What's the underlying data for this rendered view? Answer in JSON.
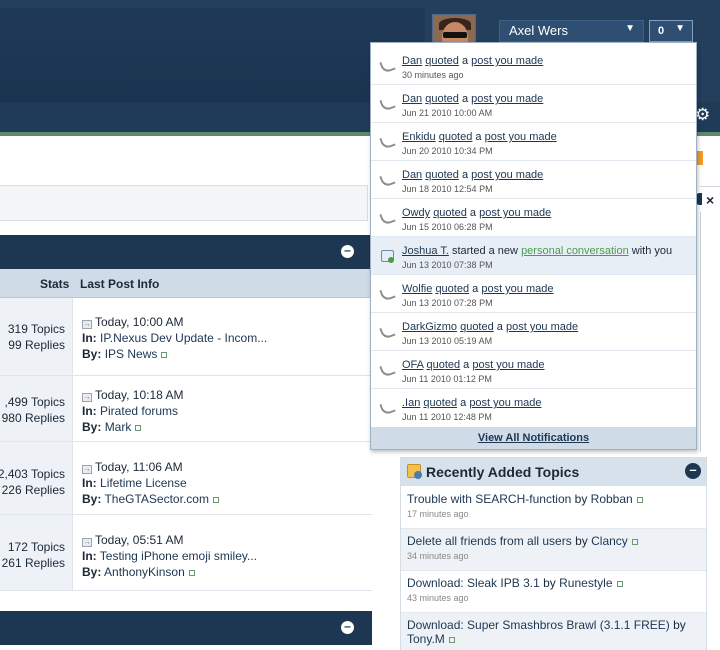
{
  "header": {
    "user_name": "Axel Wers",
    "notification_count": "0"
  },
  "forum": {
    "columns": {
      "stats": "Stats",
      "last_post": "Last Post Info"
    },
    "rows": [
      {
        "topics": "319 Topics",
        "replies": "99 Replies",
        "date": "Today, 10:00 AM",
        "in_label": "In:",
        "in_title": "IP.Nexus Dev Update - Incom...",
        "by_label": "By:",
        "by_user": "IPS News"
      },
      {
        "topics": ",499 Topics",
        "replies": "980 Replies",
        "date": "Today, 10:18 AM",
        "in_label": "In:",
        "in_title": "Pirated forums",
        "by_label": "By:",
        "by_user": "Mark"
      },
      {
        "topics": "2,403 Topics",
        "replies": "226 Replies",
        "date": "Today, 11:06 AM",
        "in_label": "In:",
        "in_title": "Lifetime License",
        "by_label": "By:",
        "by_user": "TheGTASector.com"
      },
      {
        "topics": "172 Topics",
        "replies": "261 Replies",
        "date": "Today, 05:51 AM",
        "in_label": "In:",
        "in_title": "Testing iPhone emoji smiley...",
        "by_label": "By:",
        "by_user": "AnthonyKinson"
      }
    ]
  },
  "notifications": {
    "items": [
      {
        "type": "quote",
        "user": "Dan",
        "verb": "quoted",
        "mid": " a ",
        "object": "post you made",
        "tail": "",
        "time": "30 minutes ago"
      },
      {
        "type": "quote",
        "user": "Dan",
        "verb": "quoted",
        "mid": " a ",
        "object": "post you made",
        "tail": "",
        "time": "Jun 21 2010 10:00 AM"
      },
      {
        "type": "quote",
        "user": "Enkidu",
        "verb": "quoted",
        "mid": " a ",
        "object": "post you made",
        "tail": "",
        "time": "Jun 20 2010 10:34 PM"
      },
      {
        "type": "quote",
        "user": "Dan",
        "verb": "quoted",
        "mid": " a ",
        "object": "post you made",
        "tail": "",
        "time": "Jun 18 2010 12:54 PM"
      },
      {
        "type": "quote",
        "user": "Owdy",
        "verb": "quoted",
        "mid": " a ",
        "object": "post you made",
        "tail": "",
        "time": "Jun 15 2010 06:28 PM"
      },
      {
        "type": "conversation",
        "user": "Joshua T.",
        "verb": "started a new",
        "mid": " ",
        "object": "personal conversation",
        "tail": " with you",
        "time": "Jun 13 2010 07:38 PM"
      },
      {
        "type": "quote",
        "user": "Wolfie",
        "verb": "quoted",
        "mid": " a ",
        "object": "post you made",
        "tail": "",
        "time": "Jun 13 2010 07:28 PM"
      },
      {
        "type": "quote",
        "user": "DarkGizmo",
        "verb": "quoted",
        "mid": " a ",
        "object": "post you made",
        "tail": "",
        "time": "Jun 13 2010 05:19 AM"
      },
      {
        "type": "quote",
        "user": "OFA",
        "verb": "quoted",
        "mid": " a ",
        "object": "post you made",
        "tail": "",
        "time": "Jun 11 2010 01:12 PM"
      },
      {
        "type": "quote",
        "user": ".Ian",
        "verb": "quoted",
        "mid": " a ",
        "object": "post you made",
        "tail": "",
        "time": "Jun 11 2010 12:48 PM"
      }
    ],
    "view_all": "View All Notifications"
  },
  "recent_topics": {
    "title": "Recently Added Topics",
    "items": [
      {
        "title": "Trouble with SEARCH-function",
        "by": "by",
        "user": "Robban",
        "ago": "17 minutes ago"
      },
      {
        "title": "Delete all friends from all users",
        "by": "by",
        "user": "Clancy",
        "ago": "34 minutes ago"
      },
      {
        "title": "Download: Sleak IPB 3.1",
        "by": "by",
        "user": "Runestyle",
        "ago": "43 minutes ago"
      },
      {
        "title": "Download: Super Smashbros Brawl (3.1.1 FREE)",
        "by": "by",
        "user": "Tony.M",
        "ago": ""
      }
    ]
  }
}
